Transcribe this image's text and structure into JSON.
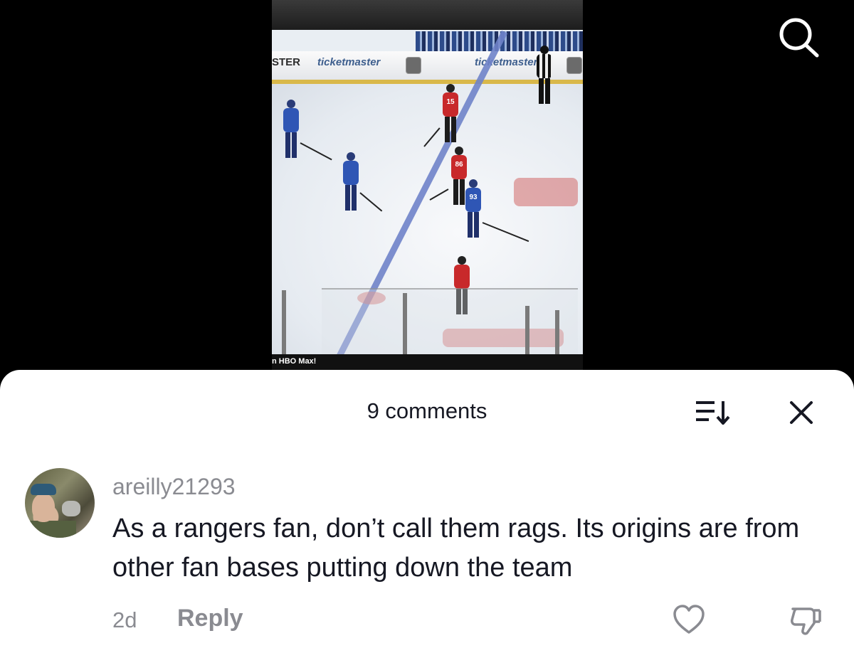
{
  "video": {
    "board_ads": {
      "left": "STER",
      "mid": "ticketmaster",
      "right": "ticketmaster"
    },
    "jersey_numbers": [
      "15",
      "86",
      "93"
    ],
    "caption": "n HBO Max!"
  },
  "top_bar": {
    "search_icon": "search-icon"
  },
  "comments_sheet": {
    "title": "9 comments",
    "sort_icon": "sort-icon",
    "close_icon": "close-icon"
  },
  "comments": [
    {
      "username": "areilly21293",
      "text": "As a rangers fan, don’t call them rags. Its origins are from other fan bases putting down the team",
      "time": "2d",
      "reply_label": "Reply",
      "like_icon": "heart-outline-icon",
      "dislike_icon": "thumbs-down-icon"
    }
  ],
  "colors": {
    "sheet_bg": "#ffffff",
    "primary_text": "#161823",
    "secondary_text": "#8a8b91",
    "page_bg": "#000000"
  }
}
